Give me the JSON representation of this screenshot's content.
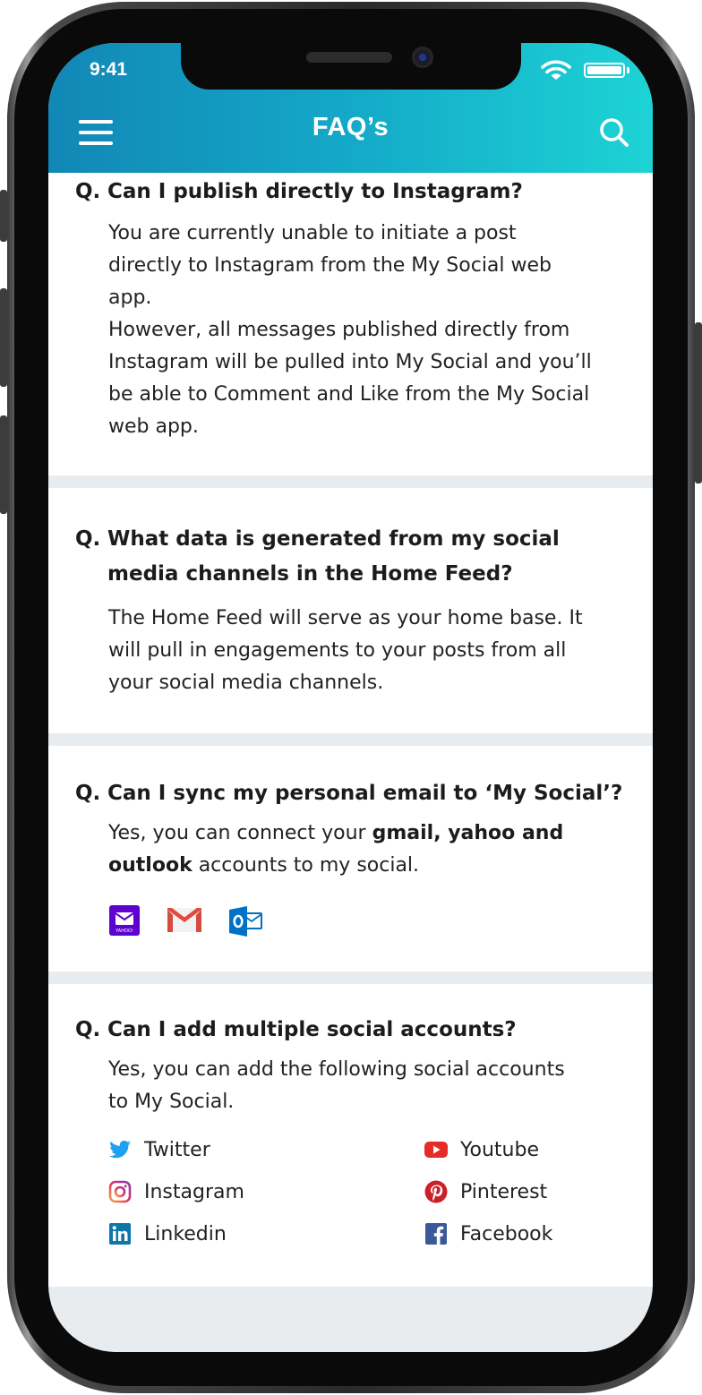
{
  "status_bar": {
    "time": "9:41"
  },
  "header": {
    "title": "FAQ’s"
  },
  "faqs": [
    {
      "prefix": "Q.",
      "question": "Can I publish directly to Instagram?",
      "answer_lines": [
        "You are currently unable to initiate a post",
        "directly to Instagram from the My Social web",
        "app.",
        "However, all messages published directly from",
        "Instagram will be pulled into My Social and you’ll",
        "be able to Comment and Like from the My Social",
        "web app."
      ]
    },
    {
      "prefix": "Q.",
      "question_lines": [
        "What data is generated from my social",
        "media channels in the Home Feed?"
      ],
      "answer_lines": [
        "The Home Feed will serve as your home base. It",
        "will pull in engagements to your posts from all",
        "your social media channels."
      ]
    },
    {
      "prefix": "Q.",
      "question": "Can I sync my personal email to ‘My Social’?",
      "answer": {
        "part1": "Yes, you can connect your ",
        "bold1": "gmail, yahoo and",
        "bold2": "outlook",
        "part2": " accounts to my social."
      },
      "mail_icons": [
        "yahoo-mail-icon",
        "gmail-icon",
        "outlook-icon"
      ],
      "yahoo_label": "YAHOO!"
    },
    {
      "prefix": "Q.",
      "question": "Can I add multiple social accounts?",
      "answer_lines": [
        "Yes, you can add the following social accounts",
        "to My Social."
      ],
      "social_accounts": [
        {
          "label": "Twitter",
          "icon": "twitter-icon",
          "color": "#1da1f2"
        },
        {
          "label": "Youtube",
          "icon": "youtube-icon",
          "color": "#e52d27"
        },
        {
          "label": "Instagram",
          "icon": "instagram-icon",
          "color": "#c13584"
        },
        {
          "label": "Pinterest",
          "icon": "pinterest-icon",
          "color": "#cb2027"
        },
        {
          "label": "Linkedin",
          "icon": "linkedin-icon",
          "color": "#0e76a8"
        },
        {
          "label": "Facebook",
          "icon": "facebook-icon",
          "color": "#3b5998"
        }
      ]
    }
  ],
  "colors": {
    "header_gradient_start": "#1187b6",
    "header_gradient_end": "#1dd3d5",
    "divider": "#e8ecee"
  }
}
